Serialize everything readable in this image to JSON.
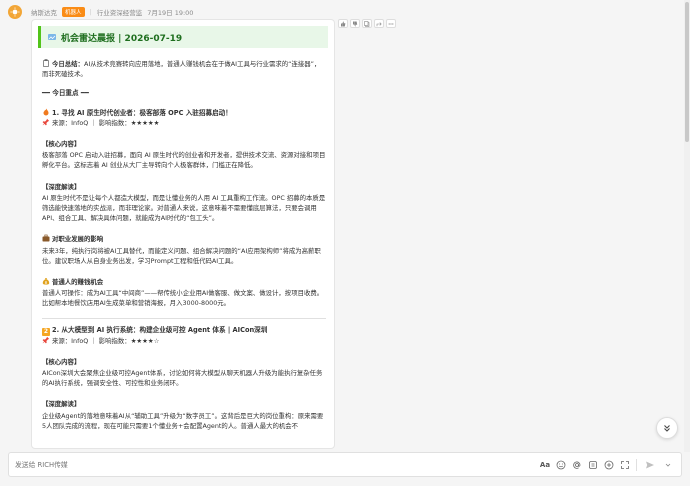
{
  "header": {
    "sender": "纳斯达克",
    "badge": "机器人",
    "group": "行业资深经营监",
    "time": "7月19日 19:00"
  },
  "card": {
    "banner_title": "机会雷达晨报 | 2026-07-19",
    "summary_label": "今日总结：",
    "summary_text": "AI从技术竞赛转向应用落地，普通人赚钱机会在于做AI工具与行业需求的“连接器”，而非死磕技术。",
    "section_title": "━━ 今日重点 ━━",
    "items": [
      {
        "num": "1",
        "title": "1. 寻找 AI 原生时代创业者：极客部落 OPC 入驻招募启动！",
        "meta": "来源：InfoQ ｜ 影响指数：★★★★★",
        "core_h": "【核心内容】",
        "core": "极客部落 OPC 启动入驻招募，面向 AI 原生时代的创业者和开发者，提供技术交流、资源对接和项目孵化平台。这标志着 AI 创业从大厂主导转向个人极客群体，门槛正在降低。",
        "deep_h": "【深度解读】",
        "deep": "AI 原生时代不是让每个人都造大模型，而是让懂业务的人用 AI 工具重构工作流。OPC 招募的本质是筛选能快速落地的实战派，而非理论家。对普通人来说，这意味着不需要懂底层算法，只要会调用 API、组合工具、解决具体问题，就能成为AI时代的“包工头”。",
        "career_h": "对职业发展的影响",
        "career": "未来3年，纯执行岗将被AI工具替代，而能定义问题、组合解决问题的“AI应用架构师”将成为高薪职位。建议职场人从自身业务出发，学习Prompt工程和低代码AI工具。",
        "chance_h": "普通人的赚钱机会",
        "chance": "普通人可操作：成为AI工具“中间商”——帮传统小企业用AI做客服、做文案、做设计，按项目收费。比如帮本地餐饮店用AI生成菜单和营销海报，月入3000-8000元。"
      },
      {
        "num": "2",
        "title": "2. 从大模型到 AI 执行系统：构建企业级可控 Agent 体系 | AICon深圳",
        "meta": "来源：InfoQ ｜ 影响指数：★★★★☆",
        "core_h": "【核心内容】",
        "core": "AICon深圳大会聚焦企业级可控Agent体系，讨论如何将大模型从聊天机器人升级为能执行复杂任务的AI执行系统，强调安全性、可控性和业务闭环。",
        "deep_h": "【深度解读】",
        "deep": "企业级Agent的落地意味着AI从“辅助工具”升级为“数字员工”。这背后是巨大的岗位重构：原来需要5人团队完成的流程，现在可能只需要1个懂业务+会配置Agent的人。普通人最大的机会不"
      }
    ]
  },
  "input": {
    "placeholder": "发送给 RICH传媒",
    "font_tool": "Aa"
  },
  "colors": {
    "banner_bg": "#e8f7e8",
    "banner_border": "#52c41a",
    "badge": "#fa8c16",
    "accent_orange": "#f5a623"
  },
  "icons": {
    "avatar": "sun-icon",
    "reactions": [
      "thumbs-up-icon",
      "thumbs-down-icon",
      "copy-icon",
      "share-icon",
      "more-icon"
    ]
  }
}
